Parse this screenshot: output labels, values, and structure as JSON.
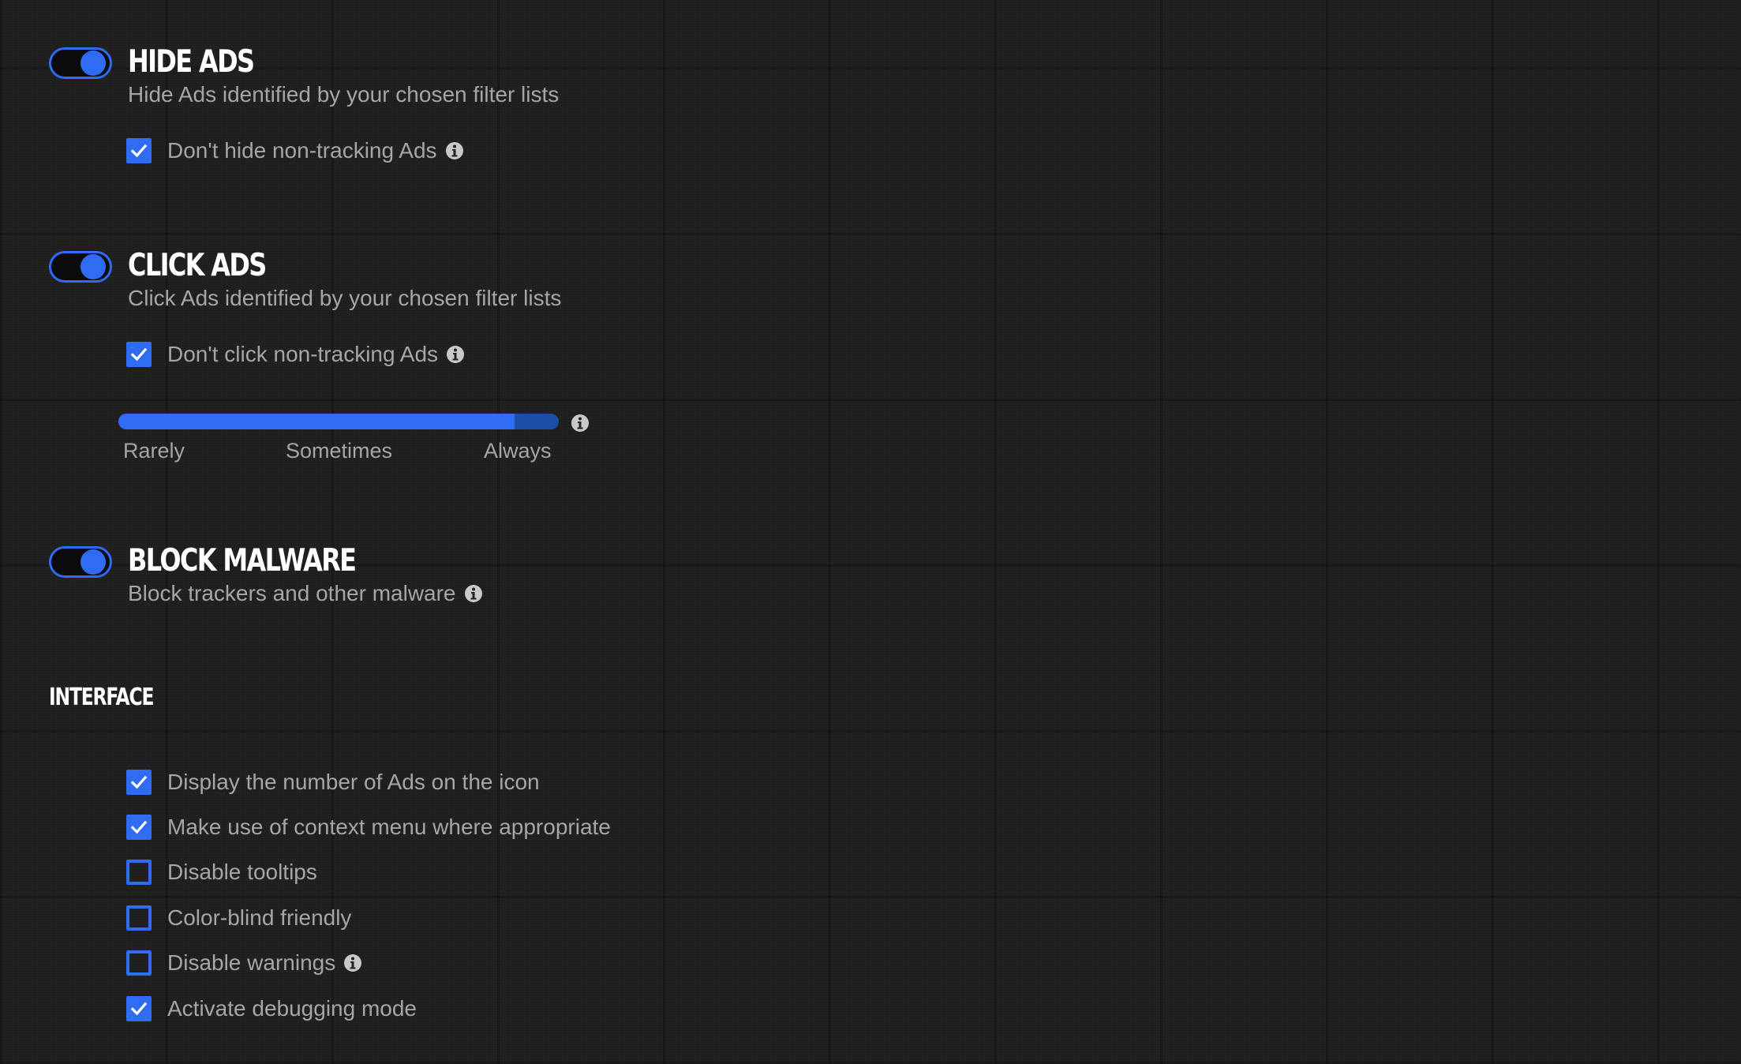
{
  "colors": {
    "accent": "#2f6cf2",
    "background": "#222222",
    "title": "#ffffff",
    "text": "#a6a6a6"
  },
  "hide_ads": {
    "enabled": true,
    "title": "HIDE ADS",
    "description": "Hide Ads identified by your chosen filter lists",
    "option": {
      "label": "Don't hide non-tracking Ads",
      "checked": true,
      "icon": "info-icon"
    }
  },
  "click_ads": {
    "enabled": true,
    "title": "CLICK ADS",
    "description": "Click Ads identified by your chosen filter lists",
    "option": {
      "label": "Don't click non-tracking Ads",
      "checked": true,
      "icon": "info-icon"
    },
    "frequency": {
      "value_fraction": 0.9,
      "labels": [
        "Rarely",
        "Sometimes",
        "Always"
      ]
    }
  },
  "block_malware": {
    "enabled": true,
    "title": "BLOCK MALWARE",
    "description": "Block trackers and other malware",
    "icon": "info-icon"
  },
  "interface": {
    "title": "INTERFACE",
    "options": [
      {
        "label": "Display the number of Ads on the icon",
        "checked": true
      },
      {
        "label": "Make use of context menu where appropriate",
        "checked": true
      },
      {
        "label": "Disable tooltips",
        "checked": false
      },
      {
        "label": "Color-blind friendly",
        "checked": false
      },
      {
        "label": "Disable warnings",
        "checked": false,
        "icon": "info-icon"
      },
      {
        "label": "Activate debugging mode",
        "checked": true
      }
    ]
  }
}
